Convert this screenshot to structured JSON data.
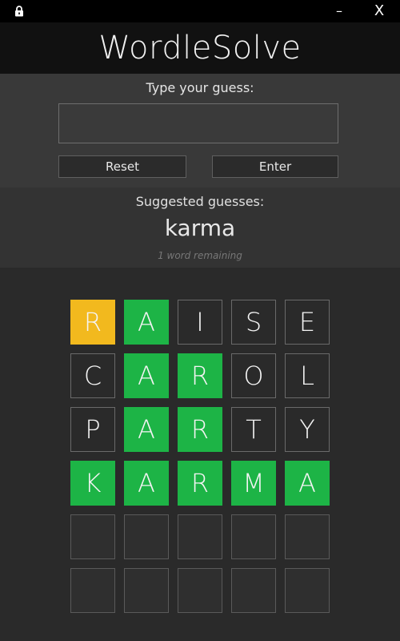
{
  "window": {
    "minimize_label": "–",
    "close_label": "X",
    "lock_icon": "lock-icon"
  },
  "app": {
    "title": "WordleSolve"
  },
  "guess": {
    "prompt": "Type your guess:",
    "value": "",
    "placeholder": "",
    "reset_label": "Reset",
    "enter_label": "Enter"
  },
  "suggestions": {
    "title": "Suggested guesses:",
    "word": "karma",
    "remaining": "1 word remaining"
  },
  "colors": {
    "green": "#1db446",
    "yellow": "#f2b91e",
    "empty": "#2f2f2f"
  },
  "board": [
    [
      {
        "letter": "R",
        "state": "yellow"
      },
      {
        "letter": "A",
        "state": "green"
      },
      {
        "letter": "I",
        "state": "absent"
      },
      {
        "letter": "S",
        "state": "absent"
      },
      {
        "letter": "E",
        "state": "absent"
      }
    ],
    [
      {
        "letter": "C",
        "state": "absent"
      },
      {
        "letter": "A",
        "state": "green"
      },
      {
        "letter": "R",
        "state": "green"
      },
      {
        "letter": "O",
        "state": "absent"
      },
      {
        "letter": "L",
        "state": "absent"
      }
    ],
    [
      {
        "letter": "P",
        "state": "absent"
      },
      {
        "letter": "A",
        "state": "green"
      },
      {
        "letter": "R",
        "state": "green"
      },
      {
        "letter": "T",
        "state": "absent"
      },
      {
        "letter": "Y",
        "state": "absent"
      }
    ],
    [
      {
        "letter": "K",
        "state": "green"
      },
      {
        "letter": "A",
        "state": "green"
      },
      {
        "letter": "R",
        "state": "green"
      },
      {
        "letter": "M",
        "state": "green"
      },
      {
        "letter": "A",
        "state": "green"
      }
    ],
    [
      {
        "letter": "",
        "state": "empty"
      },
      {
        "letter": "",
        "state": "empty"
      },
      {
        "letter": "",
        "state": "empty"
      },
      {
        "letter": "",
        "state": "empty"
      },
      {
        "letter": "",
        "state": "empty"
      }
    ],
    [
      {
        "letter": "",
        "state": "empty"
      },
      {
        "letter": "",
        "state": "empty"
      },
      {
        "letter": "",
        "state": "empty"
      },
      {
        "letter": "",
        "state": "empty"
      },
      {
        "letter": "",
        "state": "empty"
      }
    ]
  ]
}
